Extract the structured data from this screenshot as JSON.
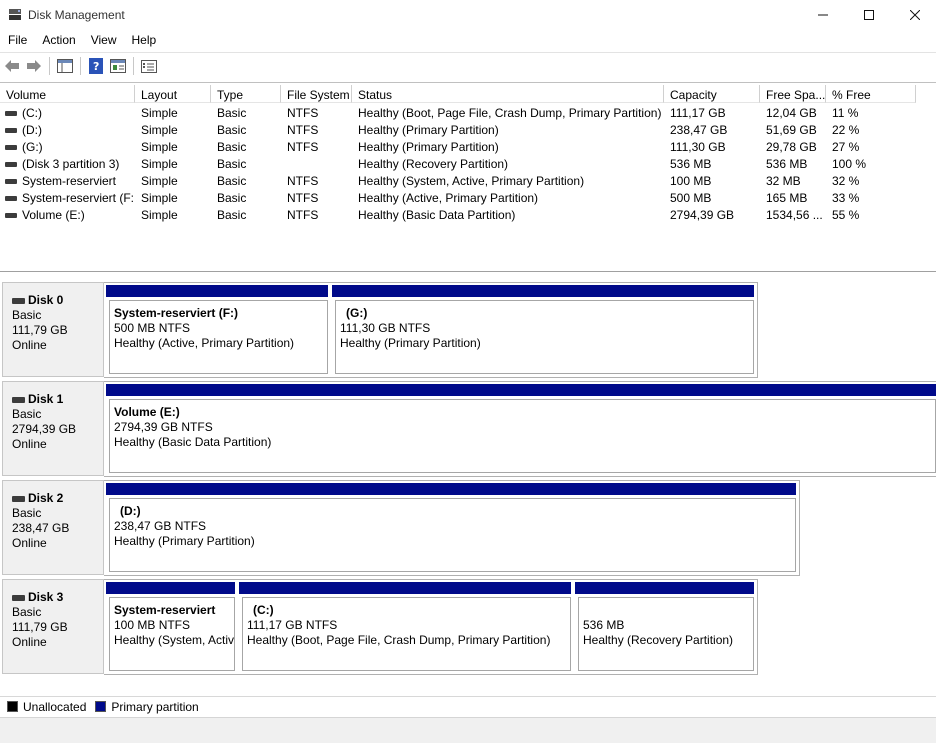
{
  "window": {
    "title": "Disk Management"
  },
  "menu": [
    "File",
    "Action",
    "View",
    "Help"
  ],
  "colors": {
    "primary_partition": "#000a8a",
    "unallocated": "#000000"
  },
  "toolbar_icons": [
    "back-arrow-icon",
    "forward-arrow-icon",
    "console-tree-icon",
    "help-icon",
    "properties-icon",
    "settings-list-icon"
  ],
  "volume_list": {
    "columns": [
      "Volume",
      "Layout",
      "Type",
      "File System",
      "Status",
      "Capacity",
      "Free Spa...",
      "% Free"
    ],
    "rows": [
      [
        "(C:)",
        "Simple",
        "Basic",
        "NTFS",
        "Healthy (Boot, Page File, Crash Dump, Primary Partition)",
        "111,17 GB",
        "12,04 GB",
        "11 %"
      ],
      [
        "(D:)",
        "Simple",
        "Basic",
        "NTFS",
        "Healthy (Primary Partition)",
        "238,47 GB",
        "51,69 GB",
        "22 %"
      ],
      [
        "(G:)",
        "Simple",
        "Basic",
        "NTFS",
        "Healthy (Primary Partition)",
        "111,30 GB",
        "29,78 GB",
        "27 %"
      ],
      [
        "(Disk 3 partition 3)",
        "Simple",
        "Basic",
        "",
        "Healthy (Recovery Partition)",
        "536 MB",
        "536 MB",
        "100 %"
      ],
      [
        "System-reserviert",
        "Simple",
        "Basic",
        "NTFS",
        "Healthy (System, Active, Primary Partition)",
        "100 MB",
        "32 MB",
        "32 %"
      ],
      [
        "System-reserviert (F:)",
        "Simple",
        "Basic",
        "NTFS",
        "Healthy (Active, Primary Partition)",
        "500 MB",
        "165 MB",
        "33 %"
      ],
      [
        "Volume (E:)",
        "Simple",
        "Basic",
        "NTFS",
        "Healthy (Basic Data Partition)",
        "2794,39 GB",
        "1534,56 ...",
        "55 %"
      ]
    ]
  },
  "disks": [
    {
      "name": "Disk 0",
      "type": "Basic",
      "size": "111,79 GB",
      "status": "Online",
      "partitions": [
        {
          "name": "System-reserviert  (F:)",
          "size": "500 MB NTFS",
          "status": "Healthy (Active, Primary Partition)"
        },
        {
          "name": "(G:)",
          "size": "111,30 GB NTFS",
          "status": "Healthy (Primary Partition)"
        }
      ]
    },
    {
      "name": "Disk 1",
      "type": "Basic",
      "size": "2794,39 GB",
      "status": "Online",
      "partitions": [
        {
          "name": "Volume  (E:)",
          "size": "2794,39 GB NTFS",
          "status": "Healthy (Basic Data Partition)"
        }
      ]
    },
    {
      "name": "Disk 2",
      "type": "Basic",
      "size": "238,47 GB",
      "status": "Online",
      "partitions": [
        {
          "name": "(D:)",
          "size": "238,47 GB NTFS",
          "status": "Healthy (Primary Partition)"
        }
      ]
    },
    {
      "name": "Disk 3",
      "type": "Basic",
      "size": "111,79 GB",
      "status": "Online",
      "partitions": [
        {
          "name": "System-reserviert",
          "size": "100 MB NTFS",
          "status": "Healthy (System, Active, Primary Partition)"
        },
        {
          "name": "(C:)",
          "size": "111,17 GB NTFS",
          "status": "Healthy (Boot, Page File, Crash Dump, Primary Partition)"
        },
        {
          "name": "",
          "size": "536 MB",
          "status": "Healthy (Recovery Partition)"
        }
      ]
    }
  ],
  "legend": {
    "unallocated": "Unallocated",
    "primary": "Primary partition"
  }
}
